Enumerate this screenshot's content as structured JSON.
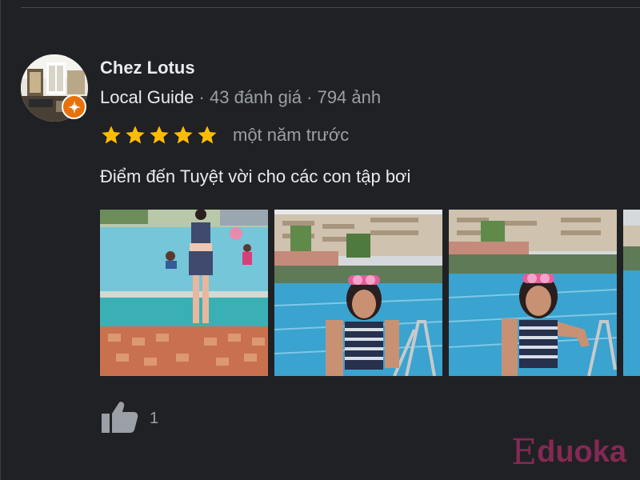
{
  "review": {
    "reviewer_name": "Chez Lotus",
    "badge": "Local Guide",
    "separator": "·",
    "review_count": "43 đánh giá",
    "photo_count": "794 ảnh",
    "rating": 5,
    "max_rating": 5,
    "time_ago": "một năm trước",
    "text": "Điểm đến Tuyệt vời cho các con tập bơi",
    "photos": [
      "pool-photo-1",
      "pool-photo-2",
      "pool-photo-3",
      "pool-photo-4"
    ],
    "like_count": "1"
  },
  "watermark": {
    "text": "duoka",
    "logo_letter": "E"
  },
  "colors": {
    "background": "#202124",
    "text_primary": "#e8eaed",
    "text_secondary": "#9aa0a6",
    "star": "#fbbc04",
    "local_guide_badge": "#e8710a",
    "watermark": "#8e2a5a"
  },
  "icons": {
    "star": "star-icon",
    "like": "thumbs-up-icon",
    "badge": "local-guide-badge-icon"
  }
}
